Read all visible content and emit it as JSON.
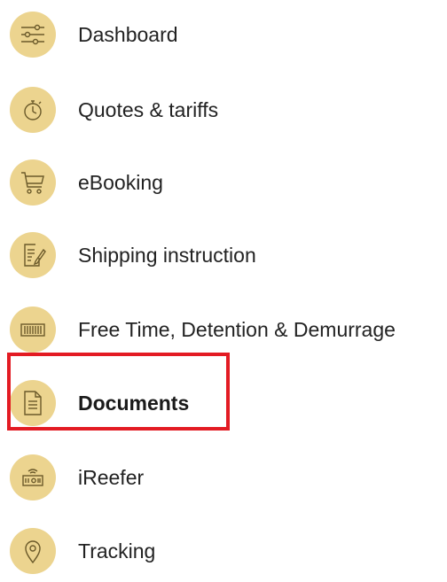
{
  "menu": {
    "items": [
      {
        "label": "Dashboard",
        "icon": "sliders-icon"
      },
      {
        "label": "Quotes & tariffs",
        "icon": "stopwatch-icon"
      },
      {
        "label": "eBooking",
        "icon": "cart-icon"
      },
      {
        "label": "Shipping instruction",
        "icon": "document-pen-icon"
      },
      {
        "label": "Free Time, Detention & Demurrage",
        "icon": "container-icon"
      },
      {
        "label": "Documents",
        "icon": "document-icon"
      },
      {
        "label": "iReefer",
        "icon": "reefer-icon"
      },
      {
        "label": "Tracking",
        "icon": "location-pin-icon"
      }
    ],
    "active_item": "Documents"
  },
  "colors": {
    "icon_background": "#ecd48f",
    "icon_stroke": "#6b5a2a",
    "highlight_border": "#e31b23",
    "text": "#222222"
  }
}
